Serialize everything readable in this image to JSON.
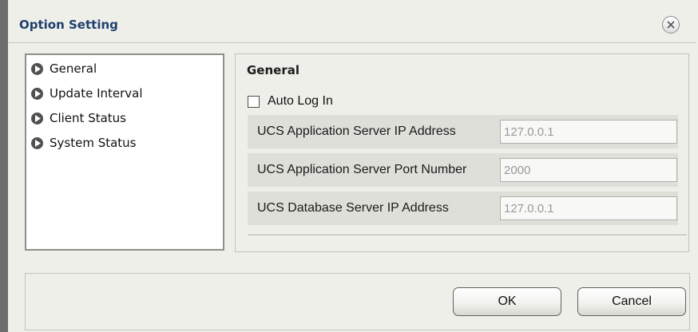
{
  "window": {
    "title": "Option Setting",
    "close_icon": "close-circle-icon"
  },
  "nav": {
    "items": [
      {
        "label": "General",
        "icon": "play-circle-icon"
      },
      {
        "label": "Update Interval",
        "icon": "play-circle-icon"
      },
      {
        "label": "Client Status",
        "icon": "play-circle-icon"
      },
      {
        "label": "System Status",
        "icon": "play-circle-icon"
      }
    ]
  },
  "general": {
    "section_title": "General",
    "auto_login": {
      "label": "Auto Log In",
      "checked": false
    },
    "fields": [
      {
        "label": "UCS Application Server IP Address",
        "value": "127.0.0.1"
      },
      {
        "label": "UCS Application Server Port Number",
        "value": "2000"
      },
      {
        "label": "UCS Database Server IP Address",
        "value": "127.0.0.1"
      }
    ]
  },
  "buttons": {
    "ok_label": "OK",
    "cancel_label": "Cancel"
  },
  "colors": {
    "title_text": "#1f3f6e",
    "dialog_bg": "#efefea",
    "field_row_bg": "#dfdfda",
    "disabled_text": "#9a9a9a"
  }
}
